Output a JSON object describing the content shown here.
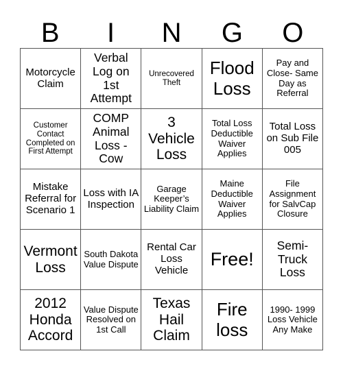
{
  "card": {
    "header": [
      "B",
      "I",
      "N",
      "G",
      "O"
    ],
    "free_space_label": "Free!",
    "rows": [
      [
        {
          "text": "Motorcycle Claim",
          "size": "fs-md"
        },
        {
          "text": "Verbal Log on 1st Attempt",
          "size": "fs-lg"
        },
        {
          "text": "Unrecovered Theft",
          "size": "fs-xs"
        },
        {
          "text": "Flood Loss",
          "size": "fs-xxl"
        },
        {
          "text": "Pay and Close- Same Day as Referral",
          "size": "fs-sm"
        }
      ],
      [
        {
          "text": "Customer Contact Completed on First Attempt",
          "size": "fs-xs"
        },
        {
          "text": "COMP Animal Loss - Cow",
          "size": "fs-lg"
        },
        {
          "text": "3 Vehicle Loss",
          "size": "fs-xl"
        },
        {
          "text": "Total Loss Deductible Waiver Applies",
          "size": "fs-sm"
        },
        {
          "text": "Total Loss on Sub File 005",
          "size": "fs-md"
        }
      ],
      [
        {
          "text": "Mistake Referral for Scenario 1",
          "size": "fs-md"
        },
        {
          "text": "Loss with IA Inspection",
          "size": "fs-md"
        },
        {
          "text": "Garage Keeper’s Liability Claim",
          "size": "fs-sm"
        },
        {
          "text": "Maine Deductible Waiver Applies",
          "size": "fs-sm"
        },
        {
          "text": "File Assignment for SalvCap Closure",
          "size": "fs-sm"
        }
      ],
      [
        {
          "text": "Vermont Loss",
          "size": "fs-xl"
        },
        {
          "text": "South Dakota Value Dispute",
          "size": "fs-sm"
        },
        {
          "text": "Rental Car Loss Vehicle",
          "size": "fs-md"
        },
        {
          "text": "Free!",
          "size": "fs-free"
        },
        {
          "text": "Semi- Truck Loss",
          "size": "fs-lg"
        }
      ],
      [
        {
          "text": "2012 Honda Accord",
          "size": "fs-xl"
        },
        {
          "text": "Value Dispute Resolved on 1st Call",
          "size": "fs-sm"
        },
        {
          "text": "Texas Hail Claim",
          "size": "fs-xl"
        },
        {
          "text": "Fire loss",
          "size": "fs-xxl"
        },
        {
          "text": "1990- 1999 Loss Vehicle Any Make",
          "size": "fs-sm"
        }
      ]
    ]
  },
  "colors": {
    "background": "#ffffff",
    "grid_line": "#555555",
    "text": "#000000"
  }
}
